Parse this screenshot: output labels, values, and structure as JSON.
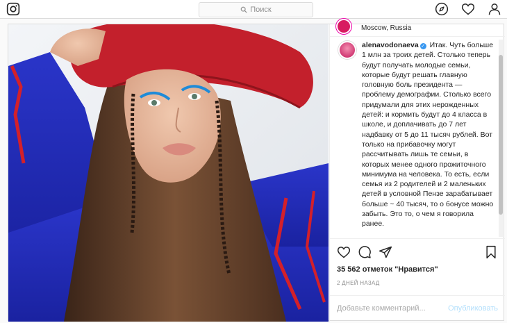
{
  "nav": {
    "search_placeholder": "Поиск"
  },
  "post": {
    "location": "Moscow, Russia",
    "author": "alenavodonaeva",
    "caption": "Итак. Чуть больше 1 млн за троих детей. Столько теперь будут получать молодые семьи, которые будут решать главную головную боль президента — проблему демографии. Столько всего придумали для этих нерожденных детей: и кормить будут до 4 класса в школе, и доплачивать до 7 лет надбавку от 5 до 11 тысяч рублей. Вот только на прибавочку могут рассчитывать лишь те семьи, в которых менее одного прожиточного минимума на человека. То есть, если семья из 2 родителей и 2 маленьких детей в условной Пензе зарабатывает больше ~ 40 тысяч, то о бонусе можно забыть. Это то, о чем я говорила ранее.",
    "likes": "35 562 отметок \"Нравится\"",
    "date": "2 ДНЕЙ НАЗАД",
    "comment_placeholder": "Добавьте комментарий...",
    "publish_label": "Опубликовать"
  },
  "colors": {
    "accent_blue": "#3897f0",
    "publish_disabled": "#b2dffc",
    "border": "#dbdbdb"
  },
  "icons": [
    "instagram-icon",
    "search-icon",
    "compass-icon",
    "heart-icon",
    "profile-icon",
    "comment-icon",
    "share-icon",
    "bookmark-icon"
  ]
}
